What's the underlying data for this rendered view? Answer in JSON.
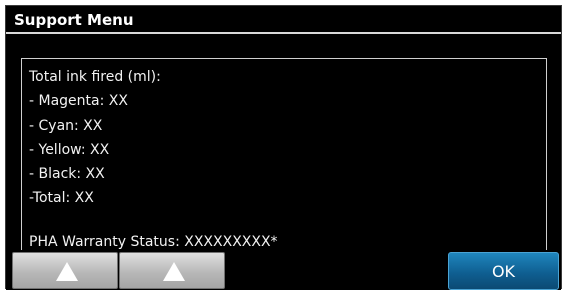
{
  "title": "Support Menu",
  "content": {
    "lines": [
      "Total ink fired (ml):",
      "- Magenta: XX",
      "- Cyan: XX",
      "- Yellow: XX",
      "- Black: XX",
      "-Total: XX"
    ],
    "warranty": "PHA Warranty Status: XXXXXXXXX*"
  },
  "buttons": {
    "scroll_up_1_icon": "up-triangle-icon",
    "scroll_up_2_icon": "up-triangle-icon",
    "ok_label": "OK"
  },
  "colors": {
    "background": "#000000",
    "ok_button": "#0f5f92",
    "scroll_button": "#b8b8b8"
  }
}
